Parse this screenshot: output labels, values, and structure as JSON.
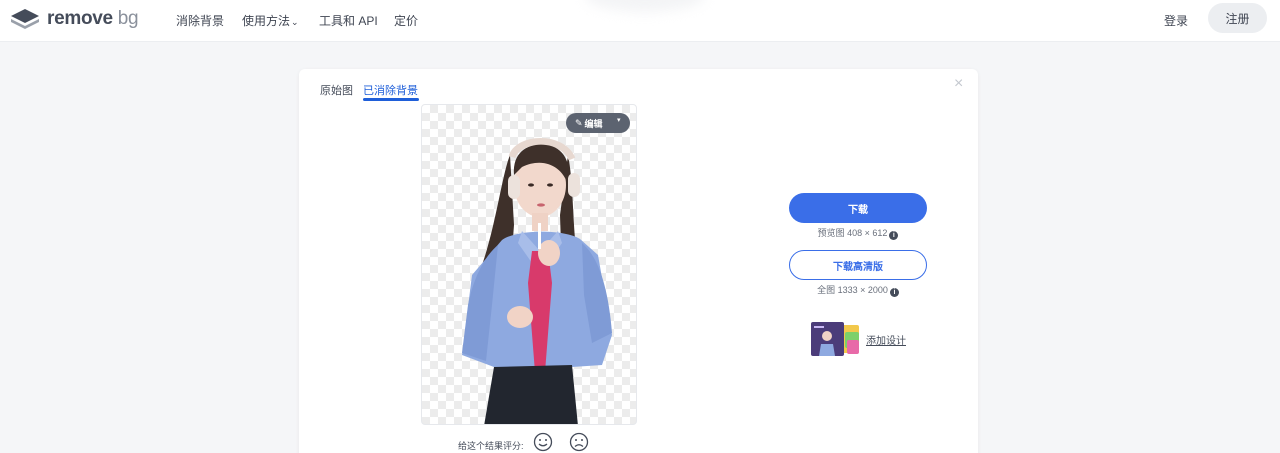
{
  "nav": {
    "logo": {
      "main": "remove",
      "suffix": "bg"
    },
    "items": [
      {
        "label": "消除背景"
      },
      {
        "label": "使用方法",
        "chevron": "⌄"
      },
      {
        "label": "工具和 API"
      },
      {
        "label": "定价"
      }
    ],
    "login": "登录",
    "signup": "注册"
  },
  "card": {
    "tabs": [
      {
        "label": "原始图",
        "active": false
      },
      {
        "label": "已消除背景",
        "active": true
      }
    ],
    "close_icon": "×",
    "edit_button": {
      "label": "编辑",
      "icon": "pencil-icon",
      "caret": "▾"
    },
    "rating": {
      "label": "给这个结果评分:"
    },
    "download": {
      "label": "下载",
      "info_label": "预览图",
      "info_size": "408 × 612"
    },
    "download_hd": {
      "label": "下载高清版",
      "info_label": "全图",
      "info_size": "1333 × 2000"
    },
    "add_design": {
      "label": "添加设计"
    },
    "info_icon": "i"
  },
  "colors": {
    "accent": "#3a6ee8",
    "tab_active": "#1f5fd9",
    "text": "#454c5a",
    "page_bg": "#f5f6f8"
  }
}
